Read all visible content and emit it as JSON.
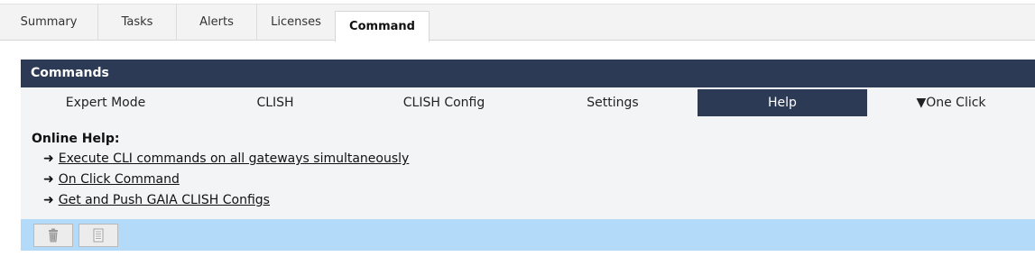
{
  "tabs": [
    {
      "label": "Summary"
    },
    {
      "label": "Tasks"
    },
    {
      "label": "Alerts"
    },
    {
      "label": "Licenses"
    },
    {
      "label": "Command"
    }
  ],
  "active_tab": "Command",
  "panel": {
    "title": "Commands",
    "subnav": [
      {
        "label": "Expert Mode"
      },
      {
        "label": "CLISH"
      },
      {
        "label": "CLISH Config"
      },
      {
        "label": "Settings"
      },
      {
        "label": "Help"
      },
      {
        "label": "▼One Click"
      }
    ],
    "active_subnav": "Help",
    "help": {
      "title": "Online Help:",
      "arrow": "➜",
      "links": [
        {
          "label": "Execute CLI commands on all gateways simultaneously"
        },
        {
          "label": "On Click Command"
        },
        {
          "label": "Get and Push GAIA CLISH Configs"
        }
      ]
    },
    "toolbar": {
      "buttons": [
        {
          "icon": "trash-icon"
        },
        {
          "icon": "document-list-icon"
        }
      ]
    }
  },
  "colors": {
    "header": "#2c3a55",
    "toolbar": "#b3daf8",
    "tabbar": "#f3f3f3"
  }
}
